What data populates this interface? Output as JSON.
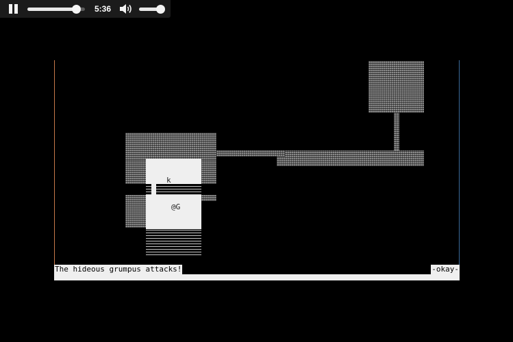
{
  "player": {
    "time": "5:36",
    "seek_progress": 0.85,
    "volume_level": 0.85,
    "icons": {
      "pause": "pause-icon",
      "volume": "speaker-icon"
    }
  },
  "map": {
    "monster_k": "k",
    "player_row": "@G"
  },
  "message": {
    "text": "The hideous grumpus attacks!",
    "prompt": "-okay-"
  }
}
